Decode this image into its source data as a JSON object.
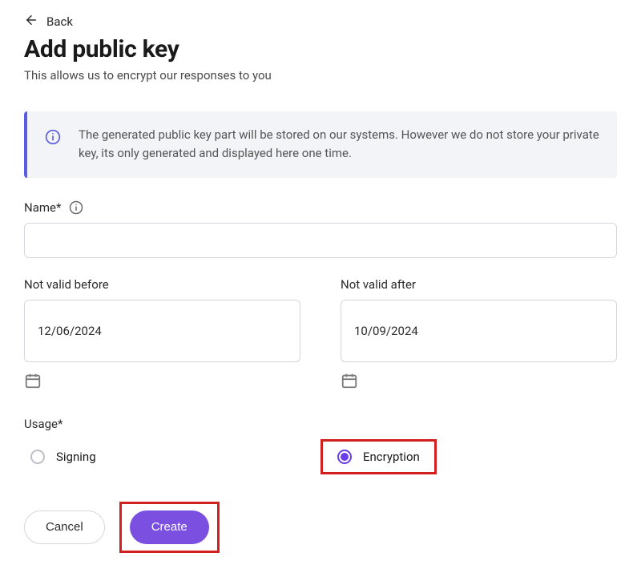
{
  "nav": {
    "back_label": "Back"
  },
  "header": {
    "title": "Add public key",
    "subtitle": "This allows us to encrypt our responses to you"
  },
  "banner": {
    "text": "The generated public key part will be stored on our systems. However we do not store your private key, its only generated and displayed here one time."
  },
  "form": {
    "name": {
      "label": "Name*",
      "value": ""
    },
    "not_valid_before": {
      "label": "Not valid before",
      "value": "12/06/2024"
    },
    "not_valid_after": {
      "label": "Not valid after",
      "value": "10/09/2024"
    },
    "usage": {
      "label": "Usage*",
      "options": {
        "signing": "Signing",
        "encryption": "Encryption"
      },
      "selected": "encryption"
    }
  },
  "actions": {
    "cancel": "Cancel",
    "create": "Create"
  }
}
